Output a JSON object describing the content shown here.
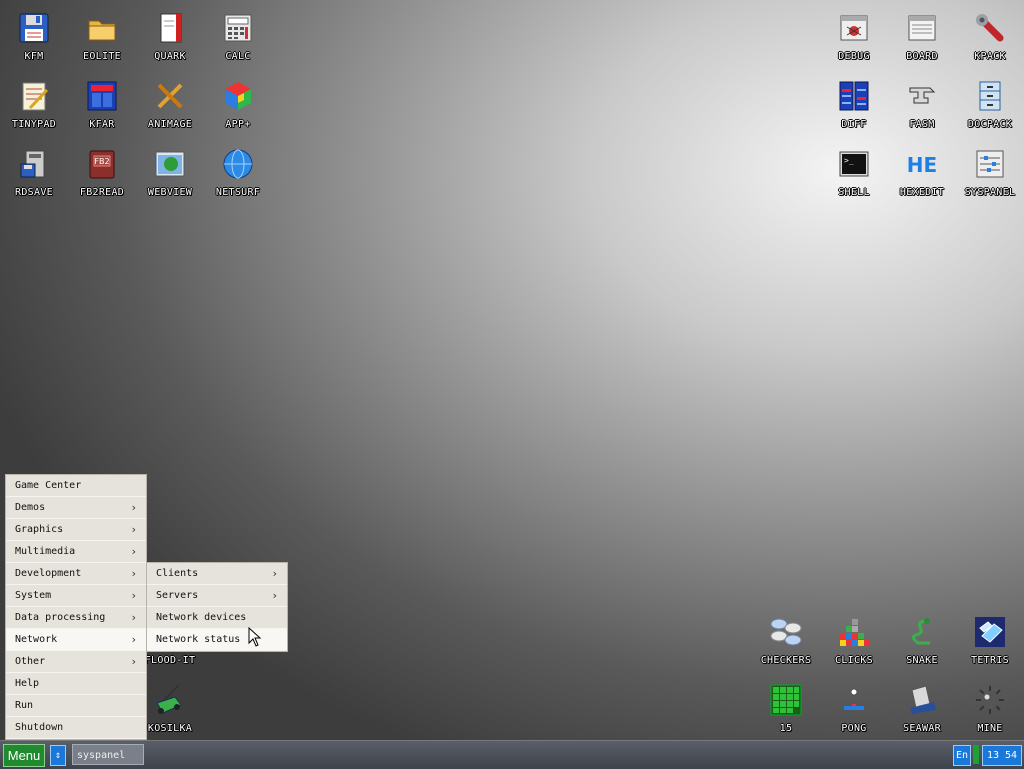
{
  "desktop": {
    "left_icons": [
      {
        "label": "KFM",
        "icon": "floppy-icon"
      },
      {
        "label": "EOLITE",
        "icon": "folder-icon"
      },
      {
        "label": "QUARK",
        "icon": "notebook-icon"
      },
      {
        "label": "CALC",
        "icon": "calculator-icon"
      },
      {
        "label": "TINYPAD",
        "icon": "notepad-icon"
      },
      {
        "label": "KFAR",
        "icon": "file-manager-icon"
      },
      {
        "label": "ANIMAGE",
        "icon": "pencil-icon"
      },
      {
        "label": "APP+",
        "icon": "cube-icon"
      },
      {
        "label": "RDSAVE",
        "icon": "rdsave-icon"
      },
      {
        "label": "FB2READ",
        "icon": "book-icon"
      },
      {
        "label": "WEBVIEW",
        "icon": "web-icon"
      },
      {
        "label": "NETSURF",
        "icon": "globe-icon"
      }
    ],
    "right_icons": [
      {
        "label": "DEBUG",
        "icon": "bug-icon"
      },
      {
        "label": "BOARD",
        "icon": "board-icon"
      },
      {
        "label": "KPACK",
        "icon": "wrench-icon"
      },
      {
        "label": "DIFF",
        "icon": "diff-icon"
      },
      {
        "label": "FASM",
        "icon": "anvil-icon"
      },
      {
        "label": "DOCPACK",
        "icon": "cabinet-icon"
      },
      {
        "label": "SHELL",
        "icon": "terminal-icon"
      },
      {
        "label": "HEXEDIT",
        "icon": "hex-icon"
      },
      {
        "label": "SYSPANEL",
        "icon": "sliders-icon"
      }
    ],
    "game_icons": [
      {
        "label": "FLOOD-IT",
        "icon": "flood-icon"
      },
      {
        "label": "CHECKERS",
        "icon": "checkers-icon"
      },
      {
        "label": "CLICKS",
        "icon": "blocks-icon"
      },
      {
        "label": "SNAKE",
        "icon": "snake-icon"
      },
      {
        "label": "TETRIS",
        "icon": "tetris-icon"
      },
      {
        "label": "KOSILKA",
        "icon": "lawnmower-icon"
      },
      {
        "label": "15",
        "icon": "grid-icon"
      },
      {
        "label": "PONG",
        "icon": "pong-icon"
      },
      {
        "label": "SEAWAR",
        "icon": "ship-icon"
      },
      {
        "label": "MINE",
        "icon": "mine-icon"
      }
    ]
  },
  "start_menu": {
    "items": [
      {
        "label": "Game Center",
        "has_sub": false
      },
      {
        "label": "Demos",
        "has_sub": true
      },
      {
        "label": "Graphics",
        "has_sub": true
      },
      {
        "label": "Multimedia",
        "has_sub": true
      },
      {
        "label": "Development",
        "has_sub": true
      },
      {
        "label": "System",
        "has_sub": true
      },
      {
        "label": "Data processing",
        "has_sub": true
      },
      {
        "label": "Network",
        "has_sub": true
      },
      {
        "label": "Other",
        "has_sub": true
      },
      {
        "label": "Help",
        "has_sub": false
      },
      {
        "label": "Run",
        "has_sub": false
      },
      {
        "label": "Shutdown",
        "has_sub": false
      }
    ],
    "arrow": "›"
  },
  "network_submenu": {
    "items": [
      {
        "label": "Clients",
        "has_sub": true
      },
      {
        "label": "Servers",
        "has_sub": true
      },
      {
        "label": "Network devices",
        "has_sub": false
      },
      {
        "label": "Network status",
        "has_sub": false
      }
    ]
  },
  "taskbar": {
    "menu_label": "Menu",
    "switch_glyph": "⇕",
    "active_task": "syspanel",
    "language": "En",
    "clock": "13 54"
  },
  "colors": {
    "menu_button": "#1f8a2e",
    "tray_blue": "#1a78d8",
    "menu_bg": "#e6e3dc"
  }
}
